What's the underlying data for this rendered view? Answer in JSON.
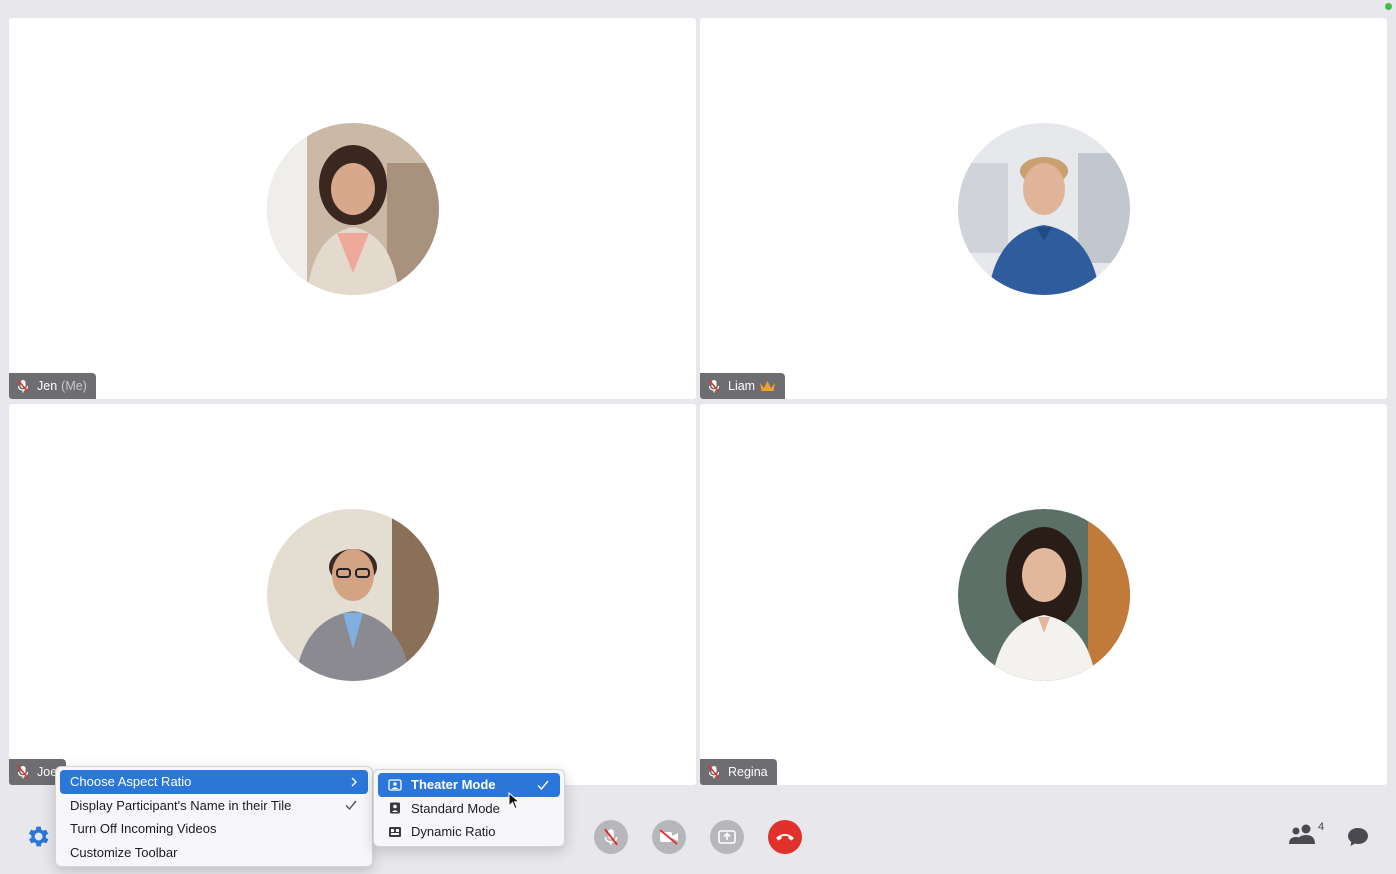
{
  "participants": [
    {
      "name": "Jen",
      "suffix": "(Me)",
      "muted": true
    },
    {
      "name": "Liam",
      "host": true,
      "muted": true
    },
    {
      "name": "Joe",
      "muted": true
    },
    {
      "name": "Regina",
      "muted": true
    }
  ],
  "toolbar": {
    "participant_count": "4"
  },
  "settings_menu": {
    "items": [
      {
        "label": "Choose Aspect Ratio",
        "active": true,
        "has_submenu": true
      },
      {
        "label": "Display Participant's Name in their Tile",
        "checked": true
      },
      {
        "label": "Turn Off Incoming Videos"
      },
      {
        "label": "Customize Toolbar"
      }
    ]
  },
  "aspect_submenu": {
    "items": [
      {
        "label": "Theater Mode",
        "active": true,
        "checked": true
      },
      {
        "label": "Standard Mode"
      },
      {
        "label": "Dynamic Ratio"
      }
    ]
  },
  "colors": {
    "accent": "#2b76d9",
    "end_call": "#e0312b",
    "tag_bg": "#6d6d72",
    "crown": "#f0a030"
  }
}
